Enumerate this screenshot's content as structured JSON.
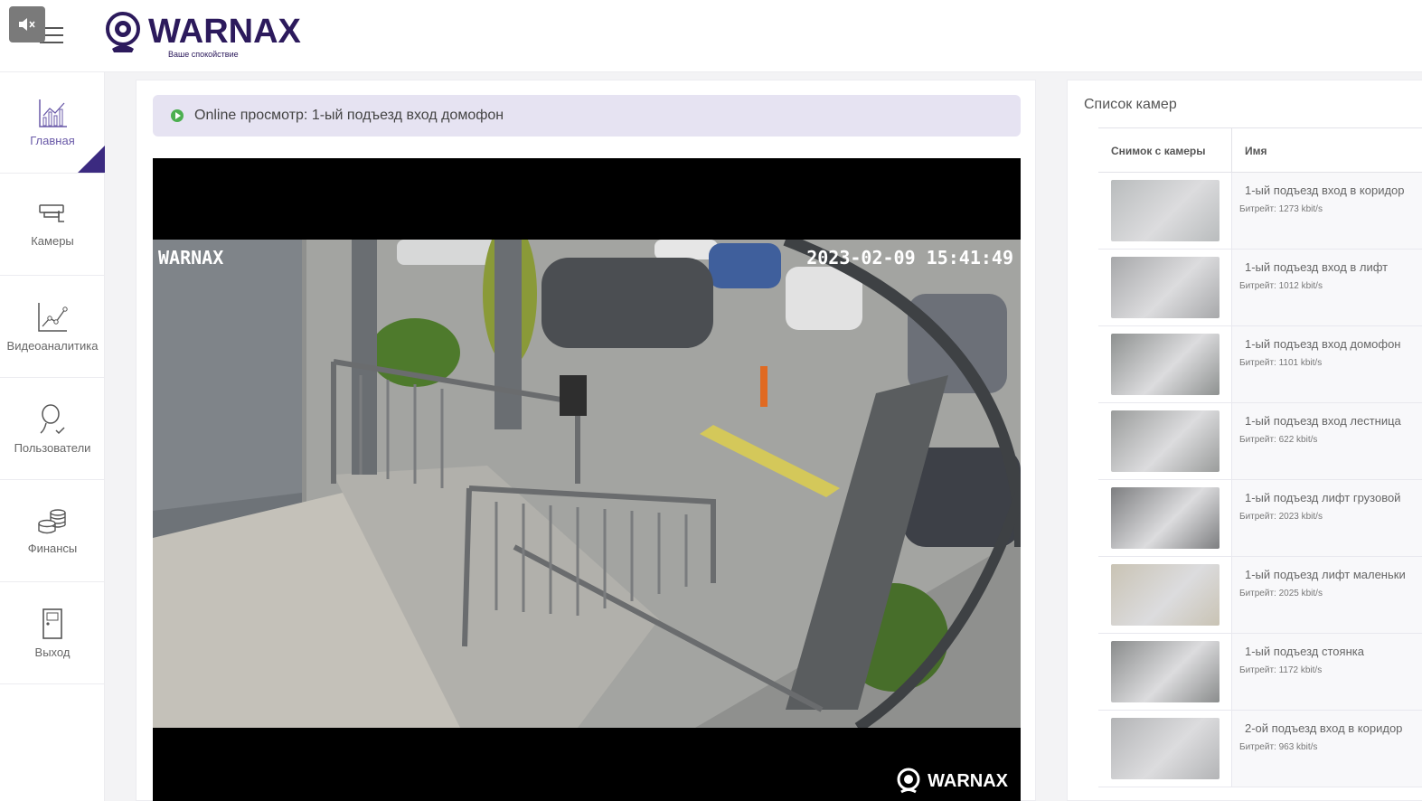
{
  "header": {
    "logo_text": "WARNAX",
    "logo_tagline": "Ваше спокойствие"
  },
  "sidebar": {
    "items": [
      {
        "label": "Главная",
        "icon": "chart-icon",
        "active": true
      },
      {
        "label": "Камеры",
        "icon": "cctv-camera-icon",
        "active": false
      },
      {
        "label": "Видеоаналитика",
        "icon": "analytics-graph-icon",
        "active": false
      },
      {
        "label": "Пользователи",
        "icon": "user-icon",
        "active": false
      },
      {
        "label": "Финансы",
        "icon": "coins-icon",
        "active": false
      },
      {
        "label": "Выход",
        "icon": "door-icon",
        "active": false
      }
    ]
  },
  "main": {
    "view_title": "Online просмотр: 1-ый подъезд вход домофон",
    "player": {
      "osd_name": "WARNAX",
      "osd_time": "2023-02-09 15:41:49",
      "watermark": "WARNAX"
    }
  },
  "camera_list": {
    "title": "Список камер",
    "col_snapshot": "Снимок с камеры",
    "col_name": "Имя",
    "rows": [
      {
        "name": "1-ый подъезд вход в коридор",
        "bitrate": "Битрейт: 1273 kbit/s",
        "tone": "#b9bcbd"
      },
      {
        "name": "1-ый подъезд вход в лифт",
        "bitrate": "Битрейт: 1012 kbit/s",
        "tone": "#a7a8aa"
      },
      {
        "name": "1-ый подъезд вход домофон",
        "bitrate": "Битрейт: 1101 kbit/s",
        "tone": "#8e9190"
      },
      {
        "name": "1-ый подъезд вход лестница",
        "bitrate": "Битрейт: 622 kbit/s",
        "tone": "#9a9c9b"
      },
      {
        "name": "1-ый подъезд лифт грузовой",
        "bitrate": "Битрейт: 2023 kbit/s",
        "tone": "#7d7e80"
      },
      {
        "name": "1-ый подъезд лифт маленьки",
        "bitrate": "Битрейт: 2025 kbit/s",
        "tone": "#c9c3b4"
      },
      {
        "name": "1-ый подъезд стоянка",
        "bitrate": "Битрейт: 1172 kbit/s",
        "tone": "#8a8c8c"
      },
      {
        "name": "2-ой подъезд вход в коридор",
        "bitrate": "Битрейт: 963 kbit/s",
        "tone": "#b3b4b6"
      }
    ]
  }
}
